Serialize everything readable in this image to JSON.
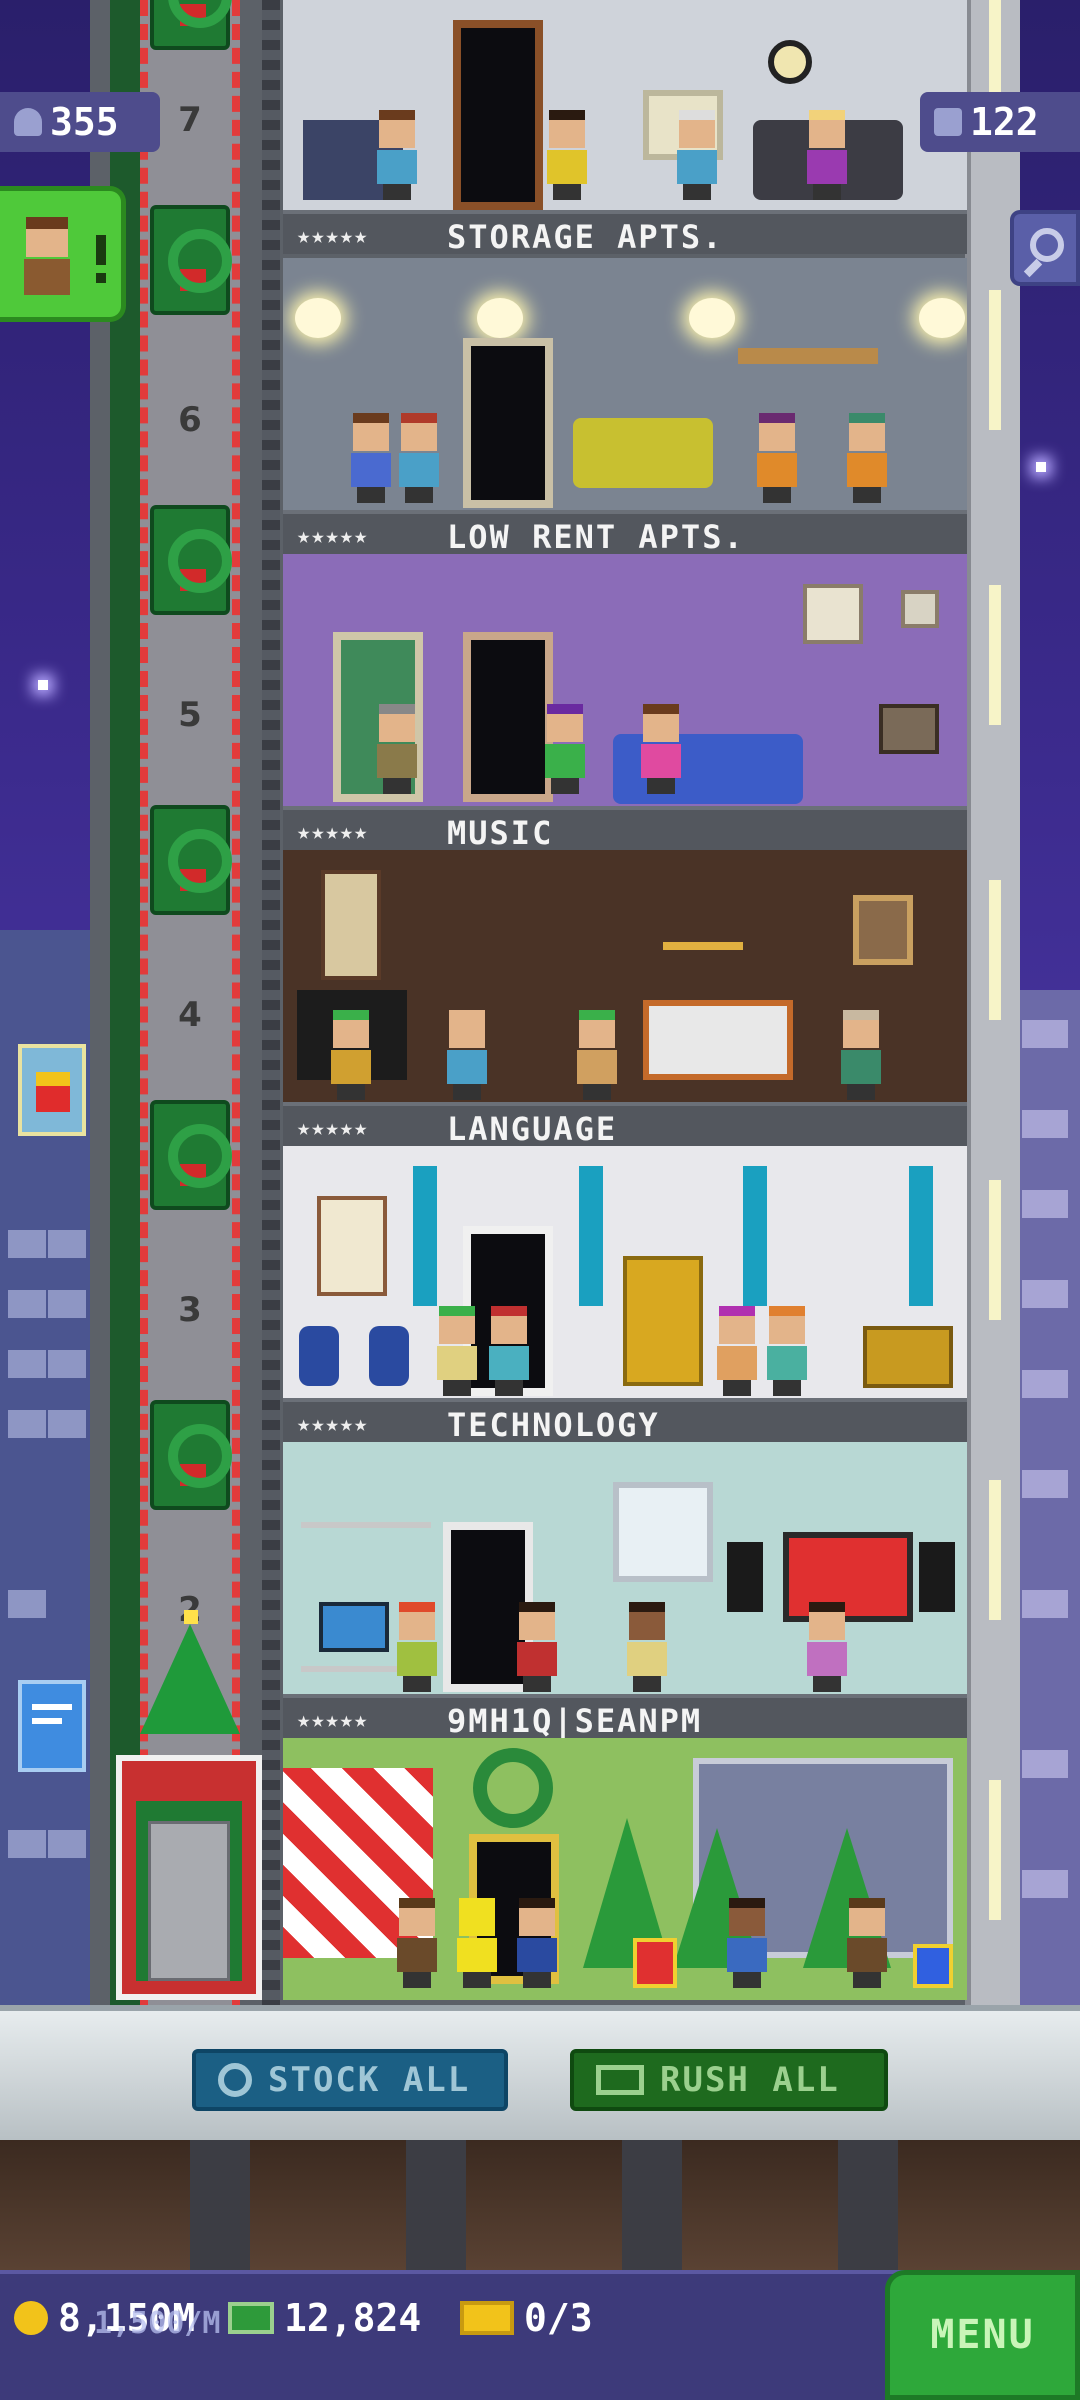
{
  "top_badges": {
    "population": "355",
    "population_icon": "person-icon",
    "bux": "122",
    "bux_icon": "building-icon"
  },
  "elevator": {
    "floor_numbers": [
      "7",
      "6",
      "5",
      "4",
      "3",
      "2"
    ]
  },
  "floors": [
    {
      "name": "STORAGE APTS.",
      "stars": "★★★★★"
    },
    {
      "name": "LOW RENT APTS.",
      "stars": "★★★★★"
    },
    {
      "name": "MUSIC",
      "stars": "★★★★★"
    },
    {
      "name": "LANGUAGE",
      "stars": "★★★★★"
    },
    {
      "name": "TECHNOLOGY",
      "stars": "★★★★★"
    },
    {
      "name": "9MH1Q|SEANPM",
      "stars": "★★★★★"
    }
  ],
  "actions": {
    "stock_all": "STOCK ALL",
    "rush_all": "RUSH ALL"
  },
  "hud": {
    "coins": "8,150M",
    "coins_overlay": "1,500/M",
    "bux": "12,824",
    "tickets": "0/3",
    "menu": "MENU"
  },
  "colors": {
    "accent_green": "#2ea83a",
    "stock_blue": "#1b5f84",
    "rush_green": "#1e6a1e",
    "sky_purple": "#3b2a8c"
  }
}
